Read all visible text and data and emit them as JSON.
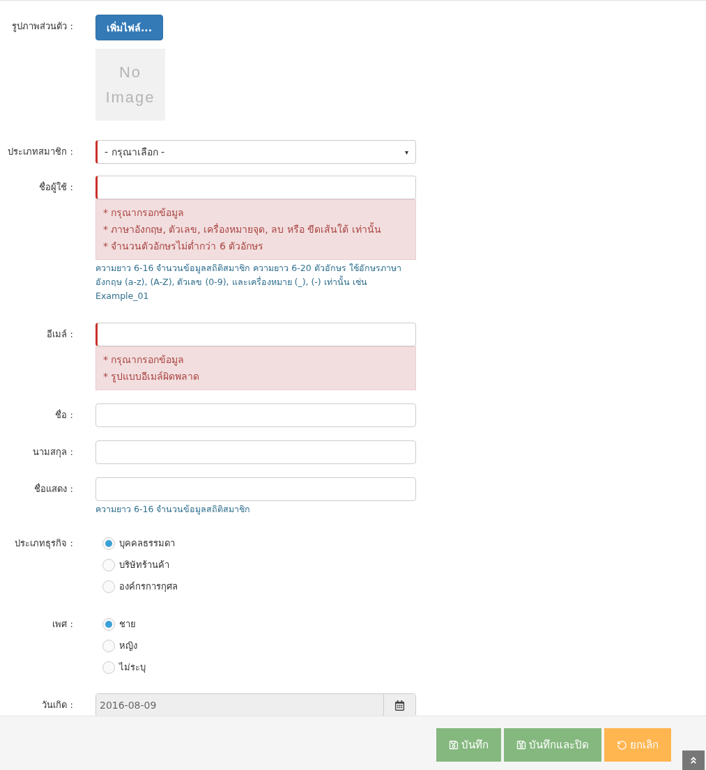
{
  "photo": {
    "label": "รูปภาพส่วนตัว :",
    "button": "เพิ่มไฟล์...",
    "no_image": "No Image"
  },
  "fields": [
    {
      "kind": "select",
      "label": "ประเภทสมาชิก :",
      "value": "- กรุณาเลือก -",
      "caret": "▾",
      "invalid": true
    },
    {
      "kind": "text",
      "label": "ชื่อผู้ใช้ :",
      "invalid": true,
      "errors": [
        "* กรุณากรอกข้อมูล",
        "* ภาษาอังกฤษ, ตัวเลข, เครื่องหมายจุด, ลบ หรือ ขีดเส้นใต้ เท่านั้น",
        "* จำนวนตัวอักษรไม่ต่ำกว่า 6 ตัวอักษร"
      ],
      "help": "ความยาว 6-16 จำนวนข้อมูลสถิติสมาชิก ความยาว 6-20 ตัวอักษร ใช้อักษรภาษาอังกฤษ (a-z), (A-Z), ตัวเลข (0-9), และเครื่องหมาย (_), (-) เท่านั้น เช่น Example_01"
    },
    {
      "kind": "text",
      "label": "อีเมล์ :",
      "invalid": true,
      "errors": [
        "* กรุณากรอกข้อมูล",
        "* รูปแบบอีเมล์ผิดพลาด"
      ]
    },
    {
      "kind": "text",
      "label": "ชื่อ :",
      "invalid": false
    },
    {
      "kind": "text",
      "label": "นามสกุล :",
      "invalid": false
    },
    {
      "kind": "text",
      "label": "ชื่อแสดง :",
      "invalid": false,
      "help": "ความยาว 6-16 จำนวนข้อมูลสถิติสมาชิก"
    },
    {
      "kind": "radio",
      "label": "ประเภทธุรกิจ :",
      "options": [
        {
          "label": "บุคคลธรรมดา",
          "selected": true
        },
        {
          "label": "บริษัทร้านค้า",
          "selected": false
        },
        {
          "label": "องค์กรการกุศล",
          "selected": false
        }
      ]
    },
    {
      "kind": "radio",
      "label": "เพศ :",
      "options": [
        {
          "label": "ชาย",
          "selected": true
        },
        {
          "label": "หญิง",
          "selected": false
        },
        {
          "label": "ไม่ระบุ",
          "selected": false
        }
      ]
    },
    {
      "kind": "date",
      "label": "วันเกิด :",
      "value": "2016-08-09"
    }
  ],
  "footer": {
    "buttons": [
      {
        "kind": "save",
        "label": "บันทึก"
      },
      {
        "kind": "save",
        "label": "บันทึกและปิด"
      },
      {
        "kind": "cancel",
        "label": "ยกเลิก"
      }
    ]
  }
}
